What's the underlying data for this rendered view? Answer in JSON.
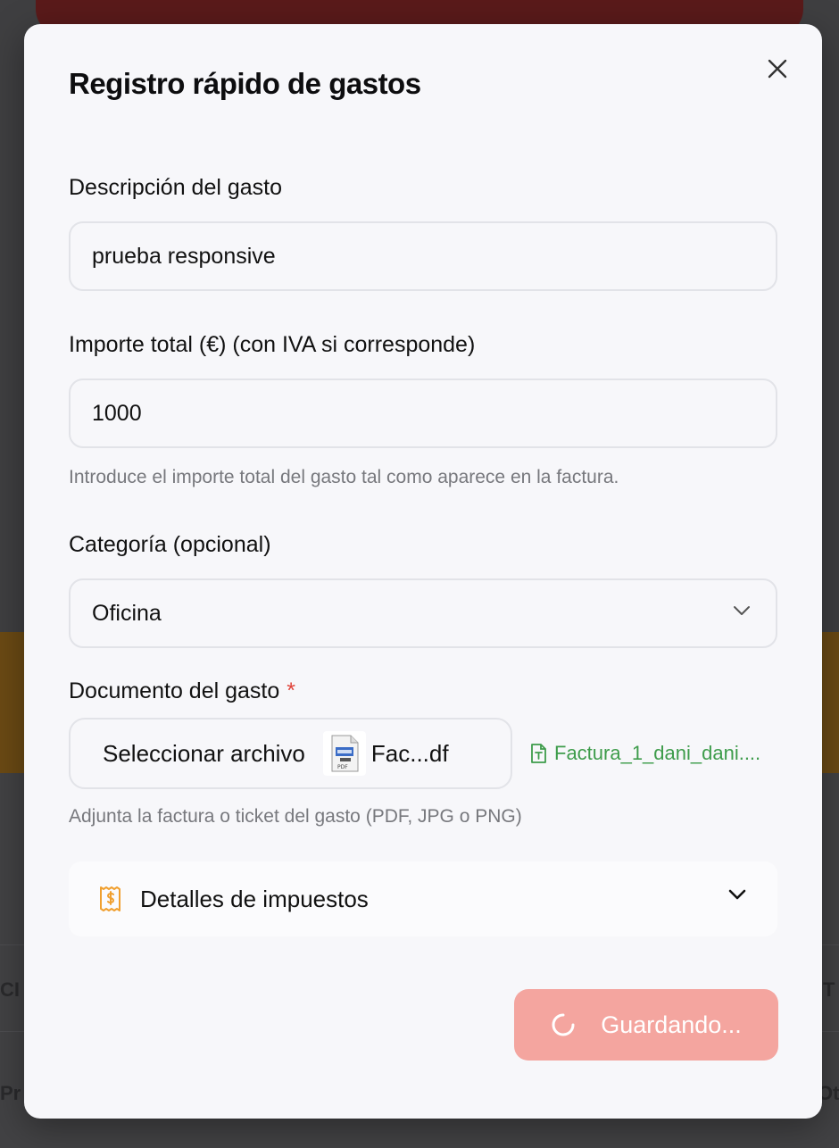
{
  "modal": {
    "title": "Registro rápido de gastos",
    "close_icon": "close-icon"
  },
  "description": {
    "label": "Descripción del gasto",
    "value": "prueba responsive"
  },
  "amount": {
    "label": "Importe total (€) (con IVA si corresponde)",
    "value": "1000",
    "helper": "Introduce el importe total del gasto tal como aparece en la factura."
  },
  "category": {
    "label": "Categoría (opcional)",
    "selected": "Oficina"
  },
  "document": {
    "label": "Documento del gasto",
    "required_mark": "*",
    "select_button": "Seleccionar archivo",
    "file_name_short": "Fac...df",
    "file_link": "Factura_1_dani_dani....",
    "helper": "Adjunta la factura o ticket del gasto (PDF, JPG o PNG)"
  },
  "tax_details": {
    "label": "Detalles de impuestos",
    "icon": "receipt-dollar-icon"
  },
  "save_button": {
    "label": "Guardando...",
    "icon": "spinner-icon"
  },
  "colors": {
    "required": "#e0443a",
    "file_link": "#3e9c4b",
    "save_button_bg": "#f4a59f",
    "tax_icon": "#f0a030"
  },
  "background": {
    "left_fragment_1": "CI",
    "left_fragment_2": "Pr",
    "right_fragment_1": "T",
    "right_fragment_2": "Otr"
  }
}
